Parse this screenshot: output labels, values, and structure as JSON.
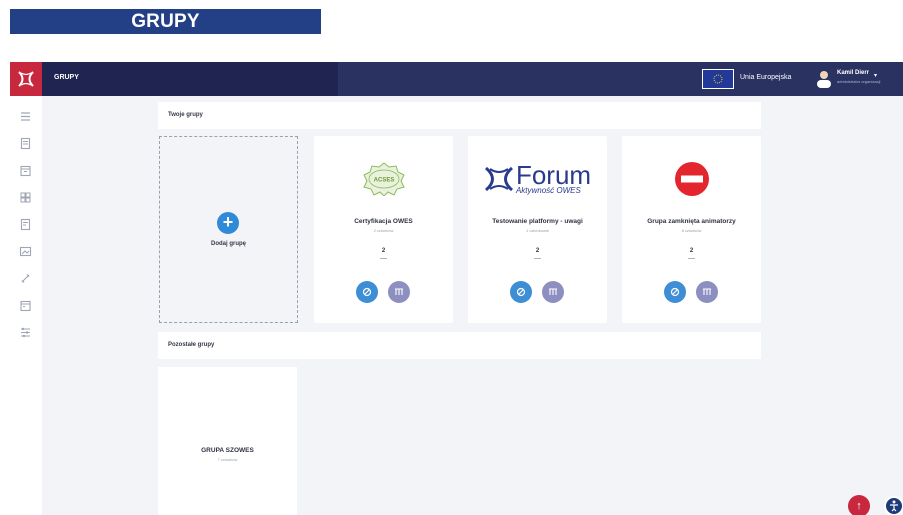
{
  "banner": {
    "title": "GRUPY"
  },
  "topbar": {
    "title": "GRUPY",
    "eu_label": "Unia Europejska",
    "user_name": "Kamil Dierr",
    "user_sub": "administrator organizacji"
  },
  "sidebar": {
    "icons": [
      "list-icon",
      "document-icon",
      "calendar-icon",
      "grid-icon",
      "document-icon",
      "image-icon",
      "link-icon",
      "calendar-icon",
      "settings-icon"
    ]
  },
  "sections": {
    "own": "Twoje grupy",
    "others": "Pozostałe grupy"
  },
  "add_card": {
    "label": "Dodaj grupę"
  },
  "cards": [
    {
      "title": "Certyfikacja OWES",
      "sub": "2 członków",
      "count": "2",
      "image": "badge",
      "badge_text": "ACSES"
    },
    {
      "title": "Testowanie platformy - uwagi",
      "sub": "1 członkowie",
      "count": "2",
      "image": "forum",
      "logo_text": "Forum",
      "logo_sub": "Aktywność OWES"
    },
    {
      "title": "Grupa zamknięta animatorzy",
      "sub": "8 członków",
      "count": "2",
      "image": "stop"
    }
  ],
  "other_cards": [
    {
      "title": "GRUPA SZOWES",
      "sub": "7 członków"
    }
  ],
  "colors": {
    "accent_blue": "#3e8ed6",
    "accent_purple": "#8c8fbf",
    "brand_red": "#c8283d",
    "nav_dark": "#1f2451"
  }
}
